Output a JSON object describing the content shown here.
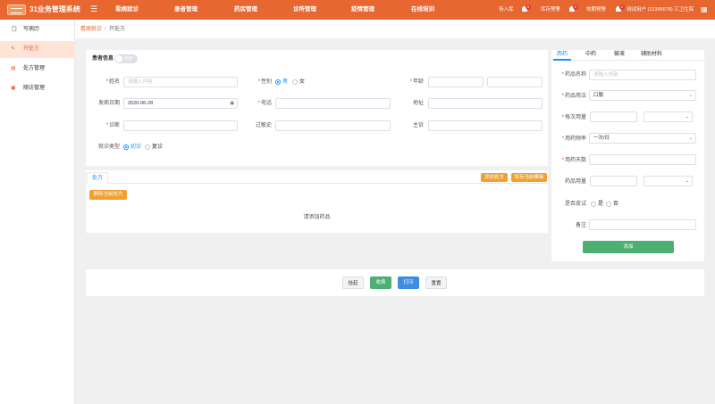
{
  "header": {
    "title": "31业务管理系统",
    "nav": [
      "看病就诊",
      "患者管理",
      "药房管理",
      "诊所管理",
      "疫情管理",
      "在线培训"
    ],
    "right": {
      "pending_label": "待入库",
      "pending_badge": "5",
      "stock_label": "库存预警",
      "stock_badge": "0",
      "expiry_label": "效期预警",
      "expiry_badge": "0",
      "user": "测试用户 (12345678) 江卫生院"
    }
  },
  "sidebar": {
    "items": [
      {
        "label": "写病历",
        "icon": "medical-record-icon"
      },
      {
        "label": "开处方",
        "icon": "pencil-icon"
      },
      {
        "label": "处方管理",
        "icon": "list-icon"
      },
      {
        "label": "随访管理",
        "icon": "calendar-icon"
      }
    ]
  },
  "breadcrumb": {
    "parent": "看病就诊",
    "separator": "/",
    "current": "开处方"
  },
  "patient": {
    "section_title": "患者信息",
    "toggle_label": "新建",
    "name_label": "姓名",
    "name_placeholder": "请输入内容",
    "gender_label": "性别",
    "gender_male": "男",
    "gender_female": "女",
    "age_label": "年龄",
    "date_label": "发病日期",
    "date_value": "2020-06-28",
    "phone_label": "电话",
    "address_label": "地址",
    "diagnosis_label": "诊断",
    "allergy_label": "过敏史",
    "complaint_label": "主诉",
    "visit_type_label": "就诊类型",
    "visit_first": "初诊",
    "visit_return": "复诊"
  },
  "prescription": {
    "tab": "处方",
    "add_button": "添加处方",
    "save_template_button": "保存当前模板",
    "delete_button": "删除当前处方",
    "empty_text": "请添加药品"
  },
  "drug_panel": {
    "tabs": [
      "西药",
      "中药",
      "输液",
      "辅助材料"
    ],
    "drug_name_label": "药品名称",
    "drug_name_placeholder": "请输入内容",
    "usage_label": "药品用法",
    "usage_value": "口服",
    "dose_label": "每次用量",
    "frequency_label": "用药频率",
    "frequency_value": "一次/日",
    "days_label": "用药天数",
    "quantity_label": "药品用量",
    "skin_test_label": "是否皮试",
    "skin_yes": "是",
    "skin_no": "否",
    "note_label": "备注",
    "add_button": "添加"
  },
  "footer": {
    "hold": "挂起",
    "charge": "收费",
    "print": "打印",
    "reset": "重置"
  },
  "colors": {
    "brand": "#e8662f",
    "primary": "#1890ff",
    "success": "#4cb073",
    "warning": "#f0a030"
  }
}
